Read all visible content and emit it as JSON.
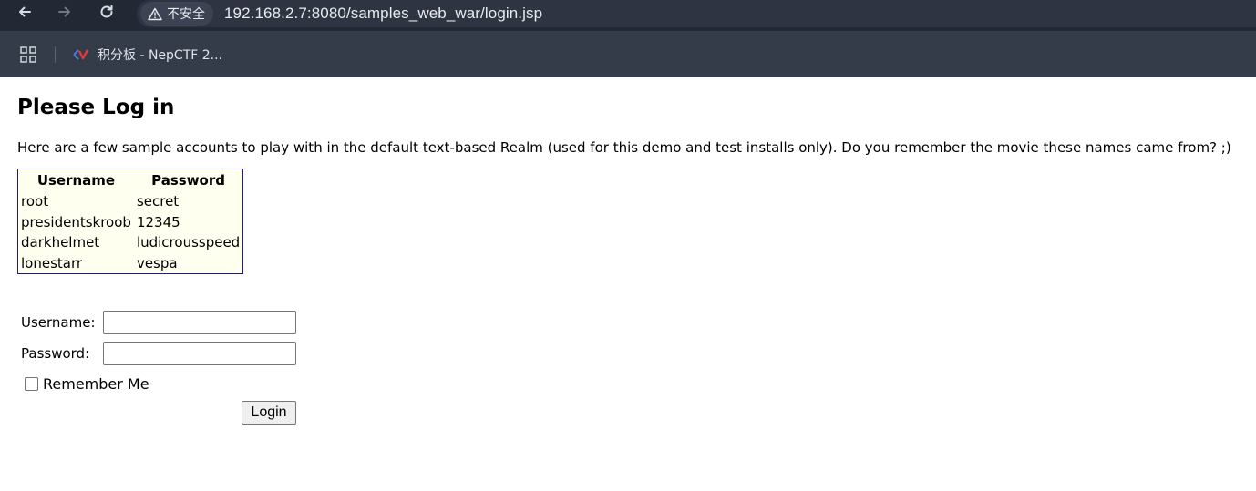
{
  "browser": {
    "security_label": "不安全",
    "url": "192.168.2.7:8080/samples_web_war/login.jsp",
    "bookmark_label": "积分板 - NepCTF 2..."
  },
  "page": {
    "title": "Please Log in",
    "intro": "Here are a few sample accounts to play with in the default text-based Realm (used for this demo and test installs only). Do you remember the movie these names came from? ;)",
    "accounts_table": {
      "headers": [
        "Username",
        "Password"
      ],
      "rows": [
        [
          "root",
          "secret"
        ],
        [
          "presidentskroob",
          "12345"
        ],
        [
          "darkhelmet",
          "ludicrousspeed"
        ],
        [
          "lonestarr",
          "vespa"
        ]
      ]
    },
    "form": {
      "username_label": "Username:",
      "username_value": "",
      "password_label": "Password:",
      "password_value": "",
      "remember_label": "Remember Me",
      "remember_checked": false,
      "login_label": "Login"
    }
  },
  "colors": {
    "toolbar_bg": "#222834",
    "bookmarks_bg": "#343b49",
    "table_bg": "#fffff0",
    "table_border": "#1c1c8c"
  }
}
